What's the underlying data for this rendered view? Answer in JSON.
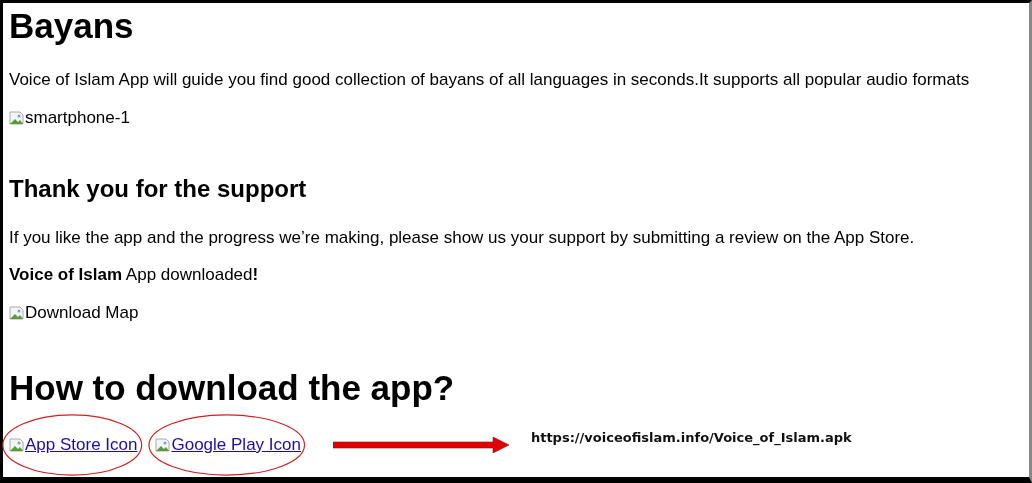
{
  "blocks": [
    {
      "kind": "h1",
      "text": "Bayans"
    },
    {
      "kind": "p",
      "text": "Voice of Islam App will guide you find good collection of bayans of all languages in seconds.It supports all popular audio formats"
    },
    {
      "kind": "img",
      "text": "smartphone-1"
    },
    {
      "kind": "h2",
      "text": "Thank you for the support"
    },
    {
      "kind": "p",
      "text": "If you like the app and the progress we’re making, please show us your support by submitting a review on the App Store."
    },
    {
      "kind": "p",
      "text": "**Voice of Islam** App downloaded**!**"
    },
    {
      "kind": "img",
      "text": "Download Map"
    },
    {
      "kind": "h1",
      "text": "How to download the app?"
    }
  ],
  "links": [
    {
      "label": "App Store Icon",
      "circled": true
    },
    {
      "label": "Google Play Icon",
      "circled": true
    }
  ],
  "annotation": {
    "url": "https://voiceofislam.info/Voice_of_Islam.apk"
  }
}
